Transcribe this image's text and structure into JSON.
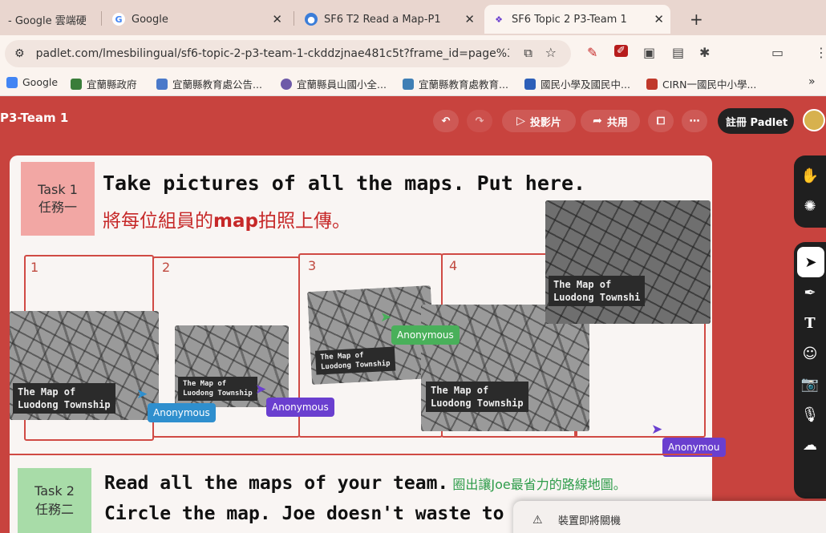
{
  "browser": {
    "tabs": [
      {
        "title": "- Google 雲端硬",
        "active": false
      },
      {
        "title": "Google",
        "active": false
      },
      {
        "title": "SF6 T2 Read a Map-P1",
        "active": false
      },
      {
        "title": "SF6 Topic 2 P3-Team 1",
        "active": true
      }
    ],
    "url": "padlet.com/lmesbilingual/sf6-topic-2-p3-team-1-ckddzjnae481c5t?frame_id=page%3AOtJ1R...",
    "bookmarks": [
      {
        "label": "Google",
        "color": "#4285f4"
      },
      {
        "label": "宜蘭縣政府",
        "color": "#3a7d3a"
      },
      {
        "label": "宜蘭縣教育處公告...",
        "color": "#4a79c9"
      },
      {
        "label": "宜蘭縣員山國小全...",
        "color": "#6e5aa8"
      },
      {
        "label": "宜蘭縣教育處教育...",
        "color": "#3f7fb5"
      },
      {
        "label": "國民小學及國民中...",
        "color": "#2d5fb8"
      },
      {
        "label": "CIRN一國民中小學...",
        "color": "#c0392b"
      }
    ]
  },
  "app": {
    "title": "P3-Team 1",
    "slideshow_label": "投影片",
    "share_label": "共用",
    "register_label": "註冊 Padlet"
  },
  "task1": {
    "label_en": "Task 1",
    "label_zh": "任務一",
    "instruction_en": "Take pictures of all the maps. Put here.",
    "instruction_zh_pre": "將每位組員的",
    "instruction_zh_word": "map",
    "instruction_zh_post": "拍照上傳。",
    "cells": [
      "1",
      "2",
      "3",
      "4"
    ],
    "map_title_line1": "The Map of",
    "map_title_line2": "Luodong Township",
    "map_title_line2_cut": "Luodong Townshi",
    "collaborators": [
      "Anonymous",
      "Anonymous",
      "Anonymous",
      "Anonymous",
      "Anonymou"
    ]
  },
  "task2": {
    "label_en": "Task 2",
    "label_zh": "任務二",
    "instruction_en_1": "Read all the maps of your team.",
    "instruction_zh": "圈出讓Joe最省力的路線地圖。",
    "instruction_en_2": "Circle the map. Joe doesn't waste to"
  },
  "notification": {
    "text": "裝置即將關機"
  },
  "colors": {
    "padlet_red": "#c8433e",
    "task1_box": "#f2a7a4",
    "task2_box": "#a8dca8",
    "anon_blue": "#2f8fce",
    "anon_purple": "#6a3fcf",
    "anon_green": "#49b05a"
  }
}
